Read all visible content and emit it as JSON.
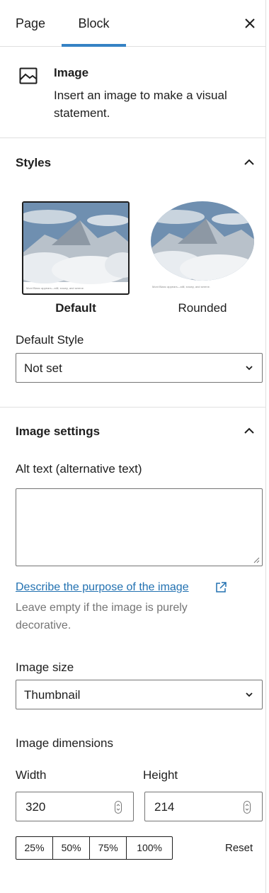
{
  "header": {
    "tabs": [
      {
        "label": "Page"
      },
      {
        "label": "Block"
      }
    ]
  },
  "block_card": {
    "title": "Image",
    "description": "Insert an image to make a visual statement."
  },
  "styles": {
    "title": "Styles",
    "variations": [
      {
        "label": "Default",
        "selected": true,
        "caption": "Mont Blanc appears—still, snowy, and serene."
      },
      {
        "label": "Rounded",
        "selected": false,
        "caption": "Mont Blanc appears—still, snowy, and serene."
      }
    ],
    "default_style_label": "Default Style",
    "default_style_value": "Not set"
  },
  "image_settings": {
    "title": "Image settings",
    "alt_label": "Alt text (alternative text)",
    "alt_value": "",
    "help_link": "Describe the purpose of the image",
    "help_text": "Leave empty if the image is purely decorative.",
    "size_label": "Image size",
    "size_value": "Thumbnail",
    "dimensions_label": "Image dimensions",
    "width_label": "Width",
    "height_label": "Height",
    "width_value": "320",
    "height_value": "214",
    "percent_options": [
      "25%",
      "50%",
      "75%",
      "100%"
    ],
    "reset_label": "Reset"
  },
  "colors": {
    "accent": "#3582c4",
    "link": "#2271b1",
    "border": "#e0e0e0",
    "muted": "#757575"
  }
}
